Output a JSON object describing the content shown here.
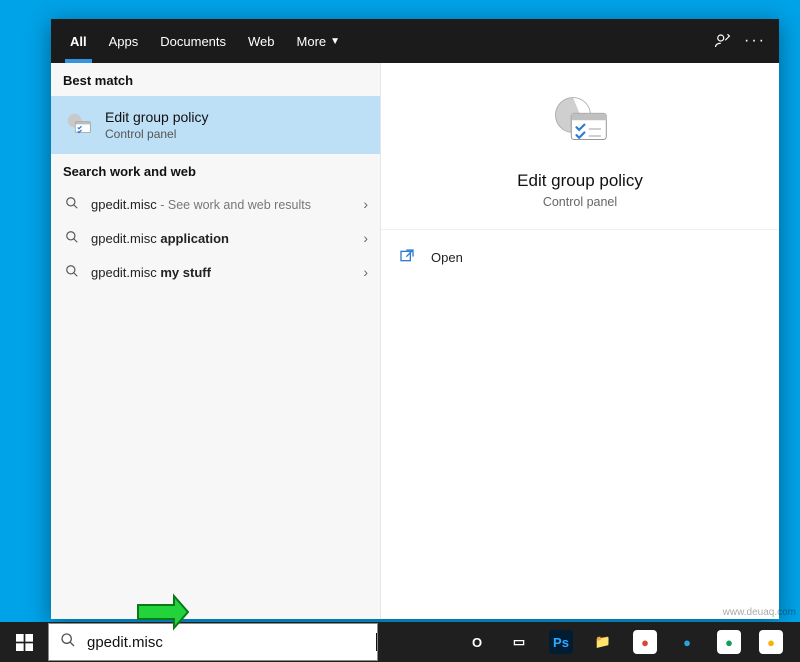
{
  "tabs": {
    "all": "All",
    "apps": "Apps",
    "documents": "Documents",
    "web": "Web",
    "more": "More"
  },
  "sections": {
    "best_match": "Best match",
    "work_web": "Search work and web"
  },
  "best_match": {
    "title": "Edit group policy",
    "subtitle": "Control panel"
  },
  "results": [
    {
      "prefix": "gpedit.misc",
      "bold": "",
      "suffix": " - See work and web results"
    },
    {
      "prefix": "gpedit.misc ",
      "bold": "application",
      "suffix": ""
    },
    {
      "prefix": "gpedit.misc ",
      "bold": "my stuff",
      "suffix": ""
    }
  ],
  "preview": {
    "title": "Edit group policy",
    "subtitle": "Control panel",
    "open": "Open"
  },
  "searchbox": {
    "value": "gpedit.misc"
  },
  "watermark": "www.deuaq.com",
  "taskbar_apps": [
    {
      "name": "cortana",
      "label": "O",
      "bg": "transparent",
      "fg": "#ffffff"
    },
    {
      "name": "taskview",
      "label": "▭",
      "bg": "transparent",
      "fg": "#ffffff"
    },
    {
      "name": "photoshop",
      "label": "Ps",
      "bg": "#001d34",
      "fg": "#31a8ff"
    },
    {
      "name": "explorer",
      "label": "📁",
      "bg": "transparent",
      "fg": "#ffd877"
    },
    {
      "name": "chrome1",
      "label": "●",
      "bg": "#ffffff",
      "fg": "#db4437"
    },
    {
      "name": "edge",
      "label": "●",
      "bg": "transparent",
      "fg": "#29a4de"
    },
    {
      "name": "chrome2",
      "label": "●",
      "bg": "#ffffff",
      "fg": "#0f9d58"
    },
    {
      "name": "chrome3",
      "label": "●",
      "bg": "#ffffff",
      "fg": "#f4b400"
    }
  ]
}
